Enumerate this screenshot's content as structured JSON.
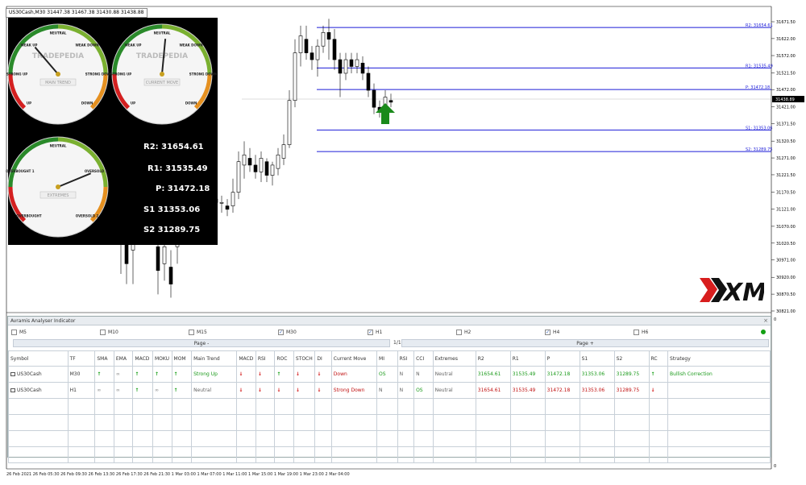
{
  "window": {
    "symbol_tab": "US30Cash,M30  31447.38 31467.38 31430.88 31438.88"
  },
  "chart_data": {
    "type": "candlestick",
    "symbol": "US30Cash",
    "timeframe": "M30",
    "price_ticks": [
      "31671.50",
      "31622.00",
      "31572.00",
      "31521.50",
      "31472.00",
      "31421.00",
      "31371.50",
      "31320.50",
      "31271.00",
      "31221.50",
      "31170.50",
      "31121.00",
      "31070.00",
      "31020.50",
      "30971.00",
      "30920.00",
      "30870.50",
      "30821.00"
    ],
    "current_price": "31438.89",
    "pivot_lines": [
      {
        "label": "R2: 31654.61",
        "value": 31654.61
      },
      {
        "label": "R1: 31535.49",
        "value": 31535.49
      },
      {
        "label": "P: 31472.18",
        "value": 31472.18
      },
      {
        "label": "S1: 31353.06",
        "value": 31353.06
      },
      {
        "label": "S2: 31289.75",
        "value": 31289.75
      }
    ],
    "x_labels": [
      "26 Feb 2021",
      "26 Feb 05:30",
      "26 Feb 09:30",
      "26 Feb 13:30",
      "26 Feb 17:30",
      "26 Feb 21:30",
      "1 Mar 03:00",
      "1 Mar 07:00",
      "1 Mar 11:00",
      "1 Mar 15:00",
      "1 Mar 19:00",
      "1 Mar 23:00",
      "2 Mar 04:00"
    ],
    "ylim": [
      30821,
      31671.5
    ]
  },
  "gauges": [
    {
      "title": "MAIN TREND",
      "brand": "TRADEPEDIA",
      "labels": [
        "UP",
        "STRONG UP",
        "WEAK UP",
        "NEUTRAL",
        "WEAK DOWN",
        "STRONG DOWN",
        "DOWN"
      ],
      "needle": 0.35
    },
    {
      "title": "CURRENT MOVE",
      "brand": "TRADEPEDIA",
      "labels": [
        "UP",
        "STRONG UP",
        "WEAK UP",
        "NEUTRAL",
        "WEAK DOWN",
        "STRONG DOWN",
        "DOWN"
      ],
      "needle": 0.52
    },
    {
      "title": "EXTREMES",
      "brand": "",
      "labels": [
        "OVERBOUGHT",
        "OVERBOUGHT 1",
        "NEUTRAL",
        "OVERSOLD 1",
        "OVERSOLD 2"
      ],
      "needle": 0.75
    }
  ],
  "pivots_overlay": {
    "r2": "R2: 31654.61",
    "r1": "R1: 31535.49",
    "p": "P: 31472.18",
    "s1": "S1 31353.06",
    "s2": "S2 31289.75"
  },
  "indicator": {
    "title": "Avramis Analyser Indicator",
    "close": "×",
    "timeframes": [
      {
        "label": "M5",
        "checked": false
      },
      {
        "label": "M10",
        "checked": false
      },
      {
        "label": "M15",
        "checked": false
      },
      {
        "label": "M30",
        "checked": true
      },
      {
        "label": "H1",
        "checked": true
      },
      {
        "label": "H2",
        "checked": false
      },
      {
        "label": "H4",
        "checked": true
      },
      {
        "label": "H6",
        "checked": false
      }
    ],
    "page_minus": "Page -",
    "page_plus": "Page +",
    "page_num": "1/1",
    "headers": [
      "Symbol",
      "TF",
      "SMA",
      "EMA",
      "MACD",
      "MOKU",
      "MOM",
      "Main Trend",
      "MACD",
      "RSI",
      "ROC",
      "STOCH",
      "DI",
      "Current Move",
      "MI",
      "RSI",
      "CCI",
      "Extremes",
      "R2",
      "R1",
      "P",
      "S1",
      "S2",
      "RC",
      "Strategy"
    ],
    "rows": [
      {
        "symbol": "US30Cash",
        "tf": "M30",
        "sma": "↑",
        "ema": "∞",
        "macd": "↑",
        "moku": "↑",
        "mom": "↑",
        "main_trend": "Strong Up",
        "macd2": "↓",
        "rsi": "↓",
        "roc": "↑",
        "stoch": "↓",
        "di": "↓",
        "current_move": "Down",
        "mi": "OS",
        "rsi2": "N",
        "cci": "N",
        "extremes": "Neutral",
        "r2": "31654.61",
        "r1": "31535.49",
        "p": "31472.18",
        "s1": "31353.06",
        "s2": "31289.75",
        "rc": "↑",
        "strategy": "Bullish Correction"
      },
      {
        "symbol": "US30Cash",
        "tf": "H1",
        "sma": "∞",
        "ema": "∞",
        "macd": "↑",
        "moku": "∞",
        "mom": "↑",
        "main_trend": "Neutral",
        "macd2": "↓",
        "rsi": "↓",
        "roc": "↓",
        "stoch": "↓",
        "di": "↓",
        "current_move": "Strong Down",
        "mi": "N",
        "rsi2": "N",
        "cci": "OS",
        "extremes": "Neutral",
        "r2": "31654.61",
        "r1": "31535.49",
        "p": "31472.18",
        "s1": "31353.06",
        "s2": "31289.75",
        "rc": "↓",
        "strategy": ""
      }
    ]
  },
  "brand_logo": "XM",
  "right_axis_bottom": "0"
}
